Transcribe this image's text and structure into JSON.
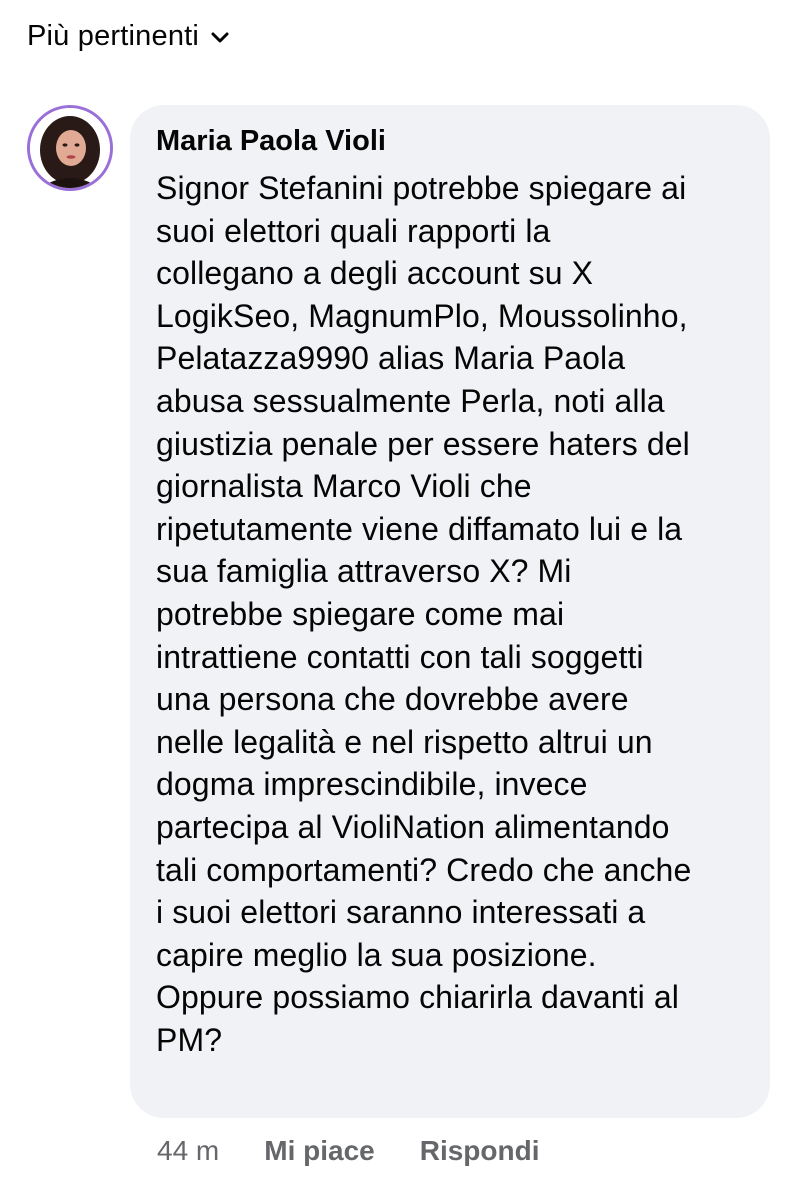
{
  "sort": {
    "label": "Più pertinenti",
    "icon": "chevron-down-icon"
  },
  "comment": {
    "author": "Maria Paola Violi",
    "avatar_ring_color": "#9b6fd8",
    "bubble_color": "#f0f2f5",
    "text": "Signor Stefanini potrebbe spiegare ai\nsuoi elettori quali rapporti la\ncollegano a degli account su X\nLogikSeo, MagnumPlo, Moussolinho,\nPelatazza9990 alias Maria Paola\nabusa sessualmente Perla, noti alla\ngiustizia penale per essere haters del\ngiornalista Marco Violi che\nripetutamente viene diffamato lui e la\nsua famiglia attraverso X? Mi\npotrebbe spiegare come mai\nintrattiene contatti con tali soggetti\nuna persona che dovrebbe avere\nnelle legalità e nel rispetto altrui un\ndogma imprescindibile, invece\npartecipa al VioliNation alimentando\ntali comportamenti? Credo che anche\ni suoi elettori saranno interessati a\ncapire meglio la sua posizione.\nOppure possiamo chiarirla davanti al\nPM?",
    "timestamp": "44 m",
    "like_label": "Mi piace",
    "reply_label": "Rispondi"
  }
}
